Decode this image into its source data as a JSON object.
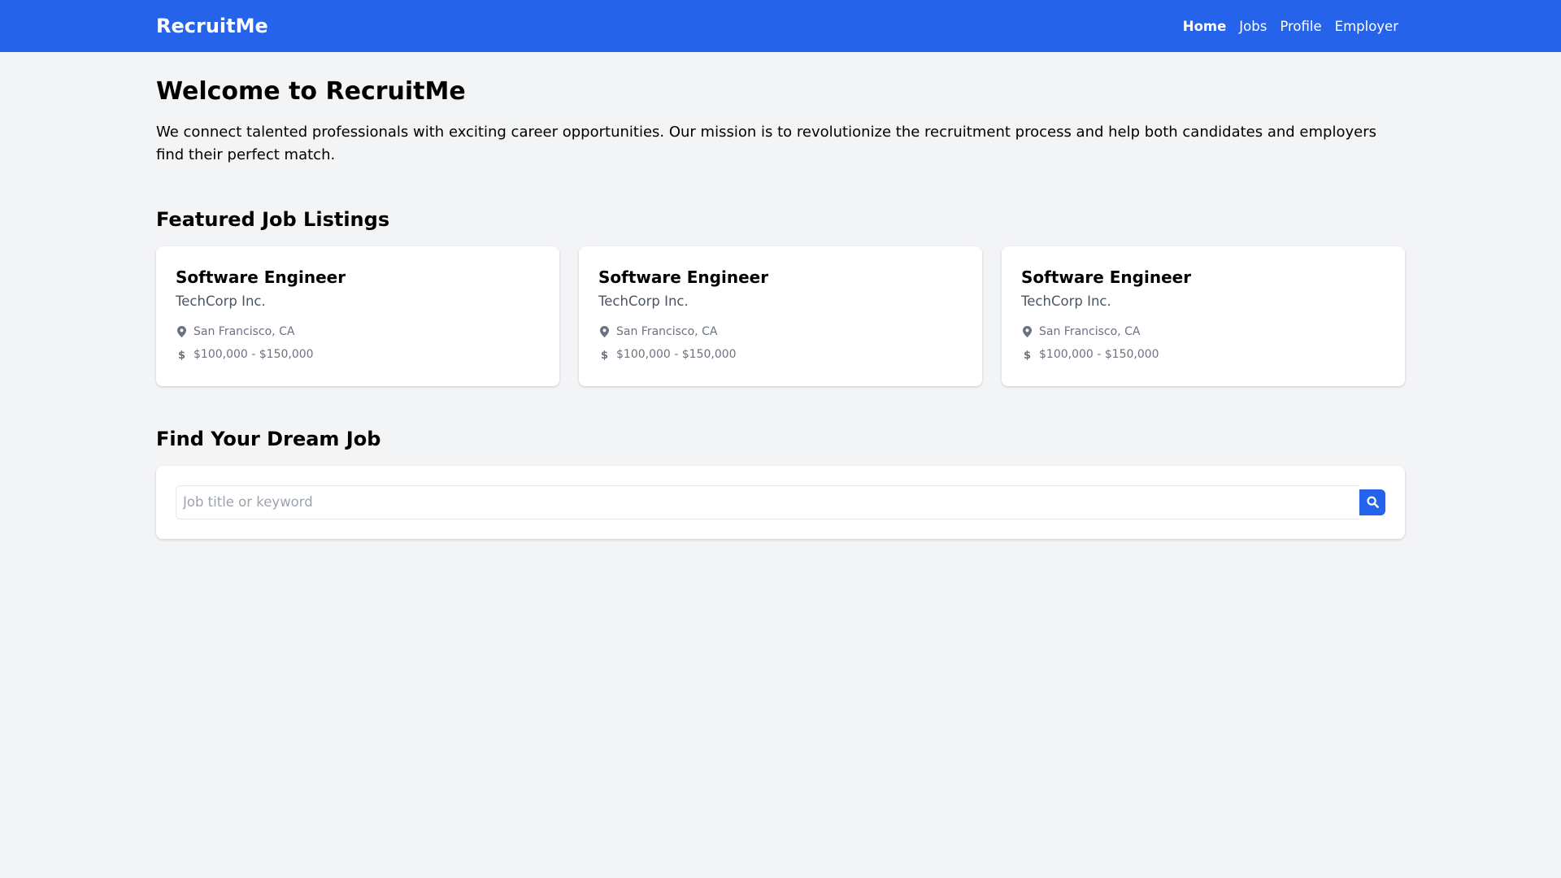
{
  "header": {
    "logo": "RecruitMe",
    "nav": [
      {
        "label": "Home",
        "active": true
      },
      {
        "label": "Jobs",
        "active": false
      },
      {
        "label": "Profile",
        "active": false
      },
      {
        "label": "Employer",
        "active": false
      }
    ]
  },
  "welcome": {
    "title": "Welcome to RecruitMe",
    "text": "We connect talented professionals with exciting career opportunities. Our mission is to revolutionize the recruitment process and help both candidates and employers find their perfect match."
  },
  "featured": {
    "title": "Featured Job Listings",
    "jobs": [
      {
        "title": "Software Engineer",
        "company": "TechCorp Inc.",
        "location": "San Francisco, CA",
        "salary": "$100,000 - $150,000",
        "location_icon": "map-marker-icon",
        "salary_icon": "dollar-icon"
      },
      {
        "title": "Software Engineer",
        "company": "TechCorp Inc.",
        "location": "San Francisco, CA",
        "salary": "$100,000 - $150,000",
        "location_icon": "map-marker-icon",
        "salary_icon": "dollar-icon"
      },
      {
        "title": "Software Engineer",
        "company": "TechCorp Inc.",
        "location": "San Francisco, CA",
        "salary": "$100,000 - $150,000",
        "location_icon": "map-marker-icon",
        "salary_icon": "dollar-icon"
      }
    ]
  },
  "search": {
    "title": "Find Your Dream Job",
    "placeholder": "Job title or keyword",
    "value": "",
    "button_icon": "search-icon"
  },
  "colors": {
    "brand": "#2563eb",
    "background": "#f3f4f6",
    "card": "#ffffff",
    "muted_text": "#6b7280",
    "company_text": "#4b5563"
  }
}
